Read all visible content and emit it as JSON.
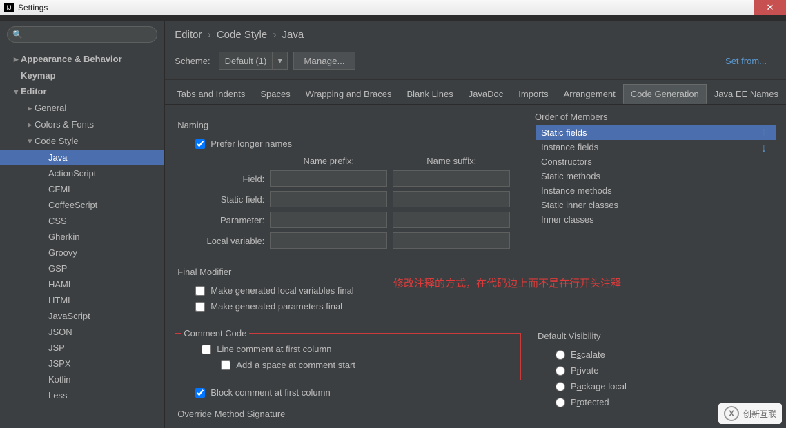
{
  "window": {
    "title": "Settings"
  },
  "sidebar": {
    "search_placeholder": "",
    "items": [
      {
        "label": "Appearance & Behavior",
        "level": 0,
        "arrow": "▸",
        "bold": true
      },
      {
        "label": "Keymap",
        "level": 0,
        "arrow": "",
        "bold": true
      },
      {
        "label": "Editor",
        "level": 0,
        "arrow": "▾",
        "bold": true
      },
      {
        "label": "General",
        "level": 1,
        "arrow": "▸"
      },
      {
        "label": "Colors & Fonts",
        "level": 1,
        "arrow": "▸"
      },
      {
        "label": "Code Style",
        "level": 1,
        "arrow": "▾"
      },
      {
        "label": "Java",
        "level": 2,
        "selected": true
      },
      {
        "label": "ActionScript",
        "level": 2
      },
      {
        "label": "CFML",
        "level": 2
      },
      {
        "label": "CoffeeScript",
        "level": 2
      },
      {
        "label": "CSS",
        "level": 2
      },
      {
        "label": "Gherkin",
        "level": 2
      },
      {
        "label": "Groovy",
        "level": 2
      },
      {
        "label": "GSP",
        "level": 2
      },
      {
        "label": "HAML",
        "level": 2
      },
      {
        "label": "HTML",
        "level": 2
      },
      {
        "label": "JavaScript",
        "level": 2
      },
      {
        "label": "JSON",
        "level": 2
      },
      {
        "label": "JSP",
        "level": 2
      },
      {
        "label": "JSPX",
        "level": 2
      },
      {
        "label": "Kotlin",
        "level": 2
      },
      {
        "label": "Less",
        "level": 2
      }
    ]
  },
  "breadcrumb": [
    "Editor",
    "Code Style",
    "Java"
  ],
  "scheme": {
    "label": "Scheme:",
    "value": "Default (1)",
    "manage": "Manage...",
    "setfrom": "Set from..."
  },
  "tabs": [
    "Tabs and Indents",
    "Spaces",
    "Wrapping and Braces",
    "Blank Lines",
    "JavaDoc",
    "Imports",
    "Arrangement",
    "Code Generation",
    "Java EE Names"
  ],
  "active_tab": "Code Generation",
  "naming": {
    "legend": "Naming",
    "prefer": "Prefer longer names",
    "prefix_head": "Name prefix:",
    "suffix_head": "Name suffix:",
    "rows": [
      "Field:",
      "Static field:",
      "Parameter:",
      "Local variable:"
    ]
  },
  "final": {
    "legend": "Final Modifier",
    "a": "Make generated local variables final",
    "b": "Make generated parameters final"
  },
  "comment": {
    "legend": "Comment Code",
    "a": "Line comment at first column",
    "b": "Add a space at comment start",
    "c": "Block comment at first column"
  },
  "override": {
    "legend": "Override Method Signature"
  },
  "members": {
    "head": "Order of Members",
    "list": [
      "Static fields",
      "Instance fields",
      "Constructors",
      "Static methods",
      "Instance methods",
      "Static inner classes",
      "Inner classes"
    ],
    "selected": "Static fields"
  },
  "visibility": {
    "legend": "Default Visibility",
    "opts": [
      {
        "pre": "E",
        "u": "s",
        "post": "calate"
      },
      {
        "pre": "P",
        "u": "r",
        "post": "ivate"
      },
      {
        "pre": "P",
        "u": "a",
        "post": "ckage local"
      },
      {
        "pre": "P",
        "u": "r",
        "post": "otected"
      }
    ]
  },
  "annotation": "修改注释的方式，在代码边上而不是在行开头注释",
  "watermark": "创新互联"
}
